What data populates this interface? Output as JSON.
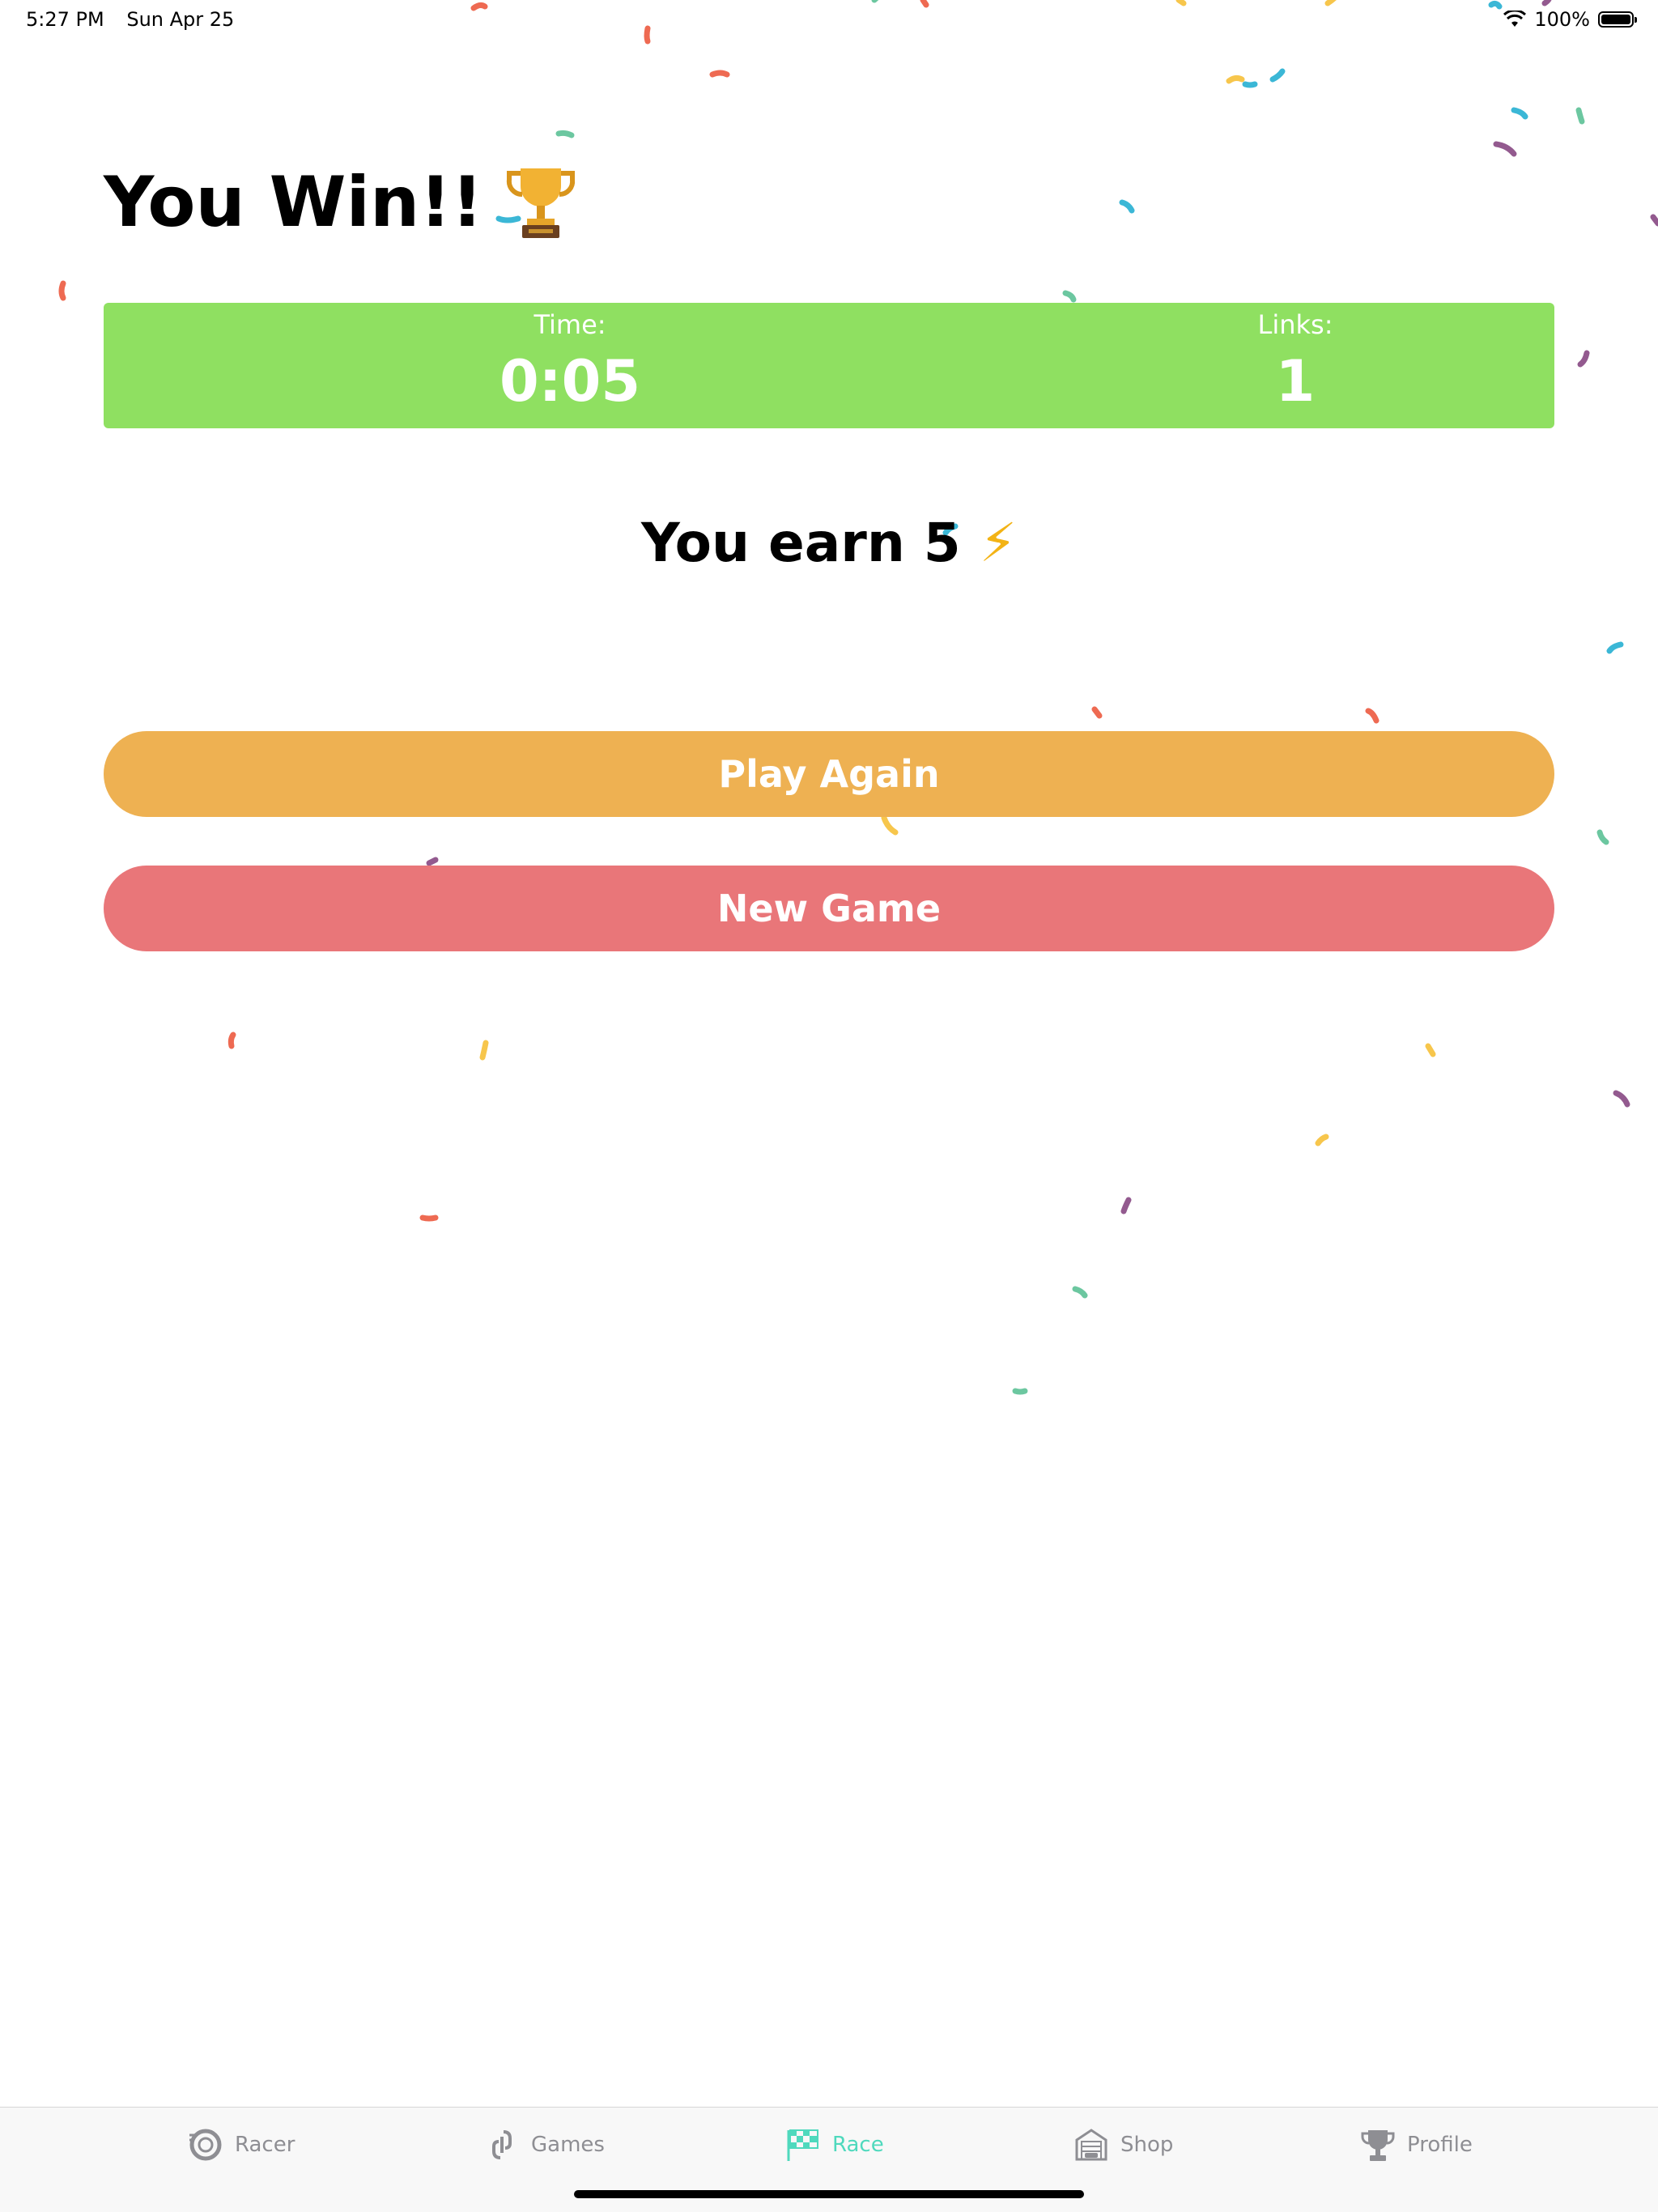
{
  "status_bar": {
    "time": "5:27 PM",
    "date": "Sun Apr 25",
    "battery": "100%"
  },
  "result": {
    "title": "You Win!!",
    "icon": "trophy-icon"
  },
  "stats": {
    "time_label": "Time:",
    "time_value": "0:05",
    "links_label": "Links:",
    "links_value": "1"
  },
  "earn": {
    "text": "You earn 5",
    "icon": "lightning-icon"
  },
  "buttons": {
    "play_again": "Play Again",
    "new_game": "New Game"
  },
  "tabs": [
    {
      "label": "Racer",
      "icon": "tire-icon"
    },
    {
      "label": "Games",
      "icon": "link-icon"
    },
    {
      "label": "Race",
      "icon": "checkered-flag-icon",
      "active": true
    },
    {
      "label": "Shop",
      "icon": "garage-icon"
    },
    {
      "label": "Profile",
      "icon": "trophy-icon"
    }
  ],
  "colors": {
    "stats_bar": "#8fe061",
    "play_again": "#eeb152",
    "new_game": "#e97679",
    "active_tab": "#4fd9bd",
    "inactive_tab": "#8e8e93"
  }
}
